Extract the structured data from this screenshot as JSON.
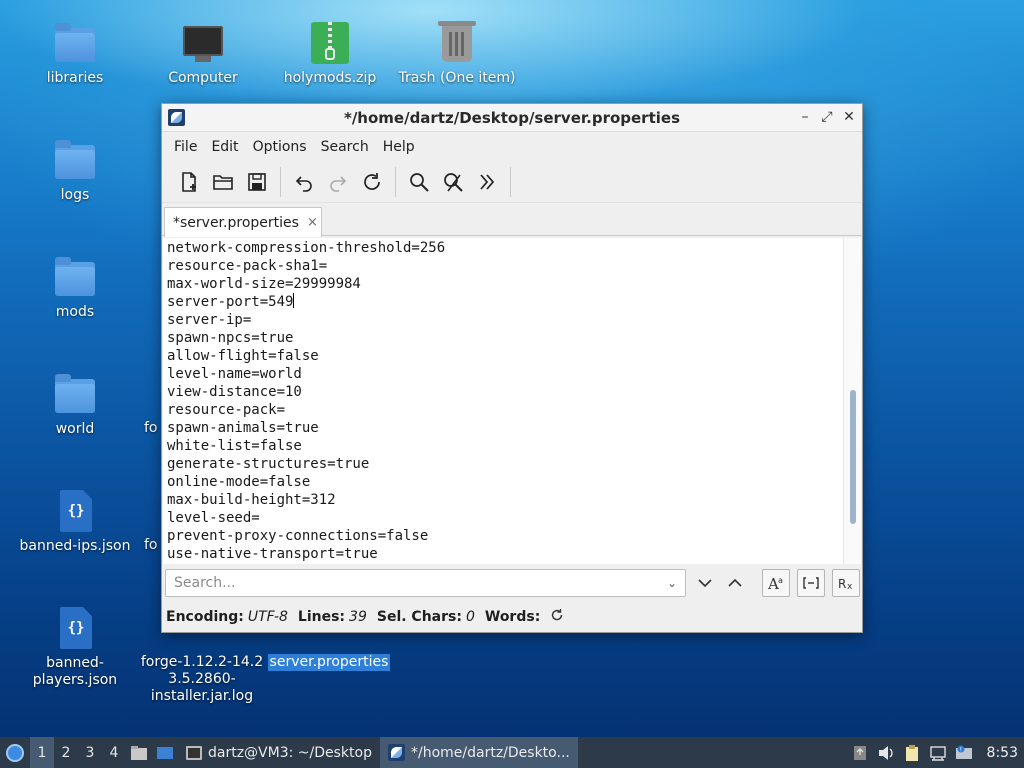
{
  "desktop": {
    "icons": [
      {
        "label": "libraries",
        "type": "folder"
      },
      {
        "label": "Computer",
        "type": "computer"
      },
      {
        "label": "holymods.zip",
        "type": "archive"
      },
      {
        "label": "Trash (One item)",
        "type": "trash"
      },
      {
        "label": "logs",
        "type": "folder"
      },
      {
        "label": "mods",
        "type": "folder"
      },
      {
        "label": "world",
        "type": "folder"
      },
      {
        "label": "banned-ips.json",
        "type": "json"
      },
      {
        "label": "banned-\nplayers.json",
        "type": "json"
      },
      {
        "label": "forge-1.12.2-14.2\n3.5.2860-\ninstaller.jar.log",
        "type": "log"
      },
      {
        "label": "server.properties",
        "type": "text",
        "selected": true
      }
    ],
    "partial_labels": [
      "fo",
      "fo"
    ]
  },
  "window": {
    "title": "*/home/dartz/Desktop/server.properties",
    "controls": {
      "minimize": "–",
      "maximize": "⤢",
      "close": "✕"
    },
    "menu": [
      "File",
      "Edit",
      "Options",
      "Search",
      "Help"
    ],
    "toolbar_icons": [
      "new-document-icon",
      "open-folder-icon",
      "save-icon",
      "undo-icon",
      "redo-icon",
      "reload-icon",
      "find-icon",
      "find-replace-icon",
      "go-to-icon"
    ],
    "tab": {
      "label": "*server.properties",
      "close": "×"
    },
    "editor_lines": [
      "network-compression-threshold=256",
      "resource-pack-sha1=",
      "max-world-size=29999984",
      "server-port=549",
      "server-ip=",
      "spawn-npcs=true",
      "allow-flight=false",
      "level-name=world",
      "view-distance=10",
      "resource-pack=",
      "spawn-animals=true",
      "white-list=false",
      "generate-structures=true",
      "online-mode=false",
      "max-build-height=312",
      "level-seed=",
      "prevent-proxy-connections=false",
      "use-native-transport=true"
    ],
    "caret_line": 3,
    "search": {
      "placeholder": "Search...",
      "value": "",
      "options": [
        "A ͣ",
        "[–]",
        "Rx"
      ]
    },
    "status": {
      "encoding_label": "Encoding:",
      "encoding_value": "UTF-8",
      "lines_label": "Lines:",
      "lines_value": "39",
      "selchars_label": "Sel. Chars:",
      "selchars_value": "0",
      "words_label": "Words:"
    }
  },
  "taskbar": {
    "workspaces": [
      "1",
      "2",
      "3",
      "4"
    ],
    "active_workspace": "1",
    "tasks": [
      {
        "label": "dartz@VM3: ~/Desktop",
        "icon": "terminal-icon"
      },
      {
        "label": "*/home/dartz/Deskto...",
        "icon": "text-editor-icon",
        "active": true
      }
    ],
    "clock": "8:53"
  },
  "colors": {
    "desktop_top": "#2a9fe0",
    "desktop_bottom": "#042f6e",
    "taskbar": "#2d3a4a",
    "selection": "#2d7fd8",
    "scroll_thumb": "#9cb3c9"
  }
}
